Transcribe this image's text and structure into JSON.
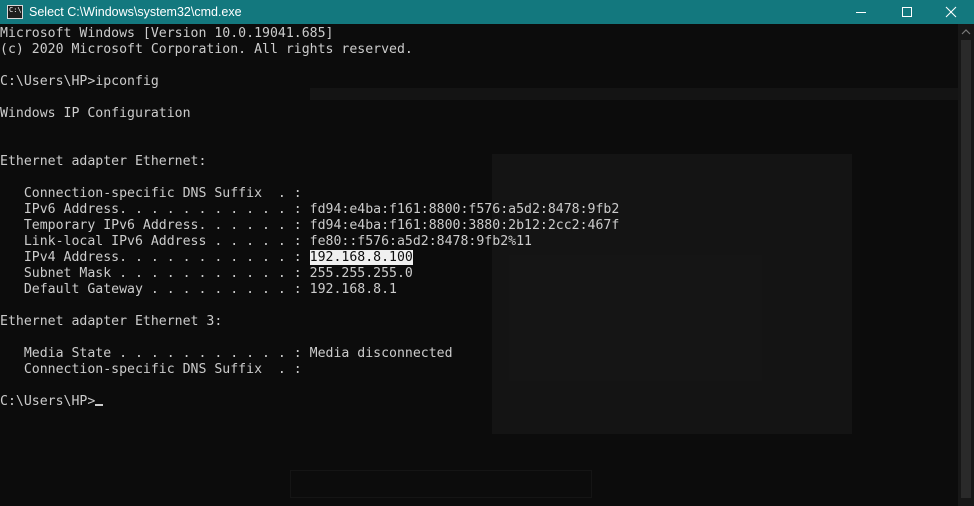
{
  "window": {
    "title": "Select C:\\Windows\\system32\\cmd.exe",
    "icon_text": "C:\\",
    "colors": {
      "titlebar": "#13787e",
      "console_bg": "#0c0c0c",
      "console_fg": "#cccccc",
      "selection_bg": "#f0f0f0"
    }
  },
  "controls": {
    "minimize_icon": "minimize-icon",
    "maximize_icon": "maximize-icon",
    "close_icon": "close-icon"
  },
  "console": {
    "lines": [
      "Microsoft Windows [Version 10.0.19041.685]",
      "(c) 2020 Microsoft Corporation. All rights reserved.",
      "",
      "C:\\Users\\HP>ipconfig",
      "",
      "Windows IP Configuration",
      "",
      "",
      "Ethernet adapter Ethernet:",
      "",
      "   Connection-specific DNS Suffix  . :",
      "   IPv6 Address. . . . . . . . . . . : fd94:e4ba:f161:8800:f576:a5d2:8478:9fb2",
      "   Temporary IPv6 Address. . . . . . : fd94:e4ba:f161:8800:3880:2b12:2cc2:467f",
      "   Link-local IPv6 Address . . . . . : fe80::f576:a5d2:8478:9fb2%11"
    ],
    "ipv4_prefix": "   IPv4 Address. . . . . . . . . . . : ",
    "ipv4_value": "192.168.8.100",
    "lines_after": [
      "   Subnet Mask . . . . . . . . . . . : 255.255.255.0",
      "   Default Gateway . . . . . . . . . : 192.168.8.1",
      "",
      "Ethernet adapter Ethernet 3:",
      "",
      "   Media State . . . . . . . . . . . : Media disconnected",
      "   Connection-specific DNS Suffix  . :",
      ""
    ],
    "prompt": "C:\\Users\\HP>"
  }
}
